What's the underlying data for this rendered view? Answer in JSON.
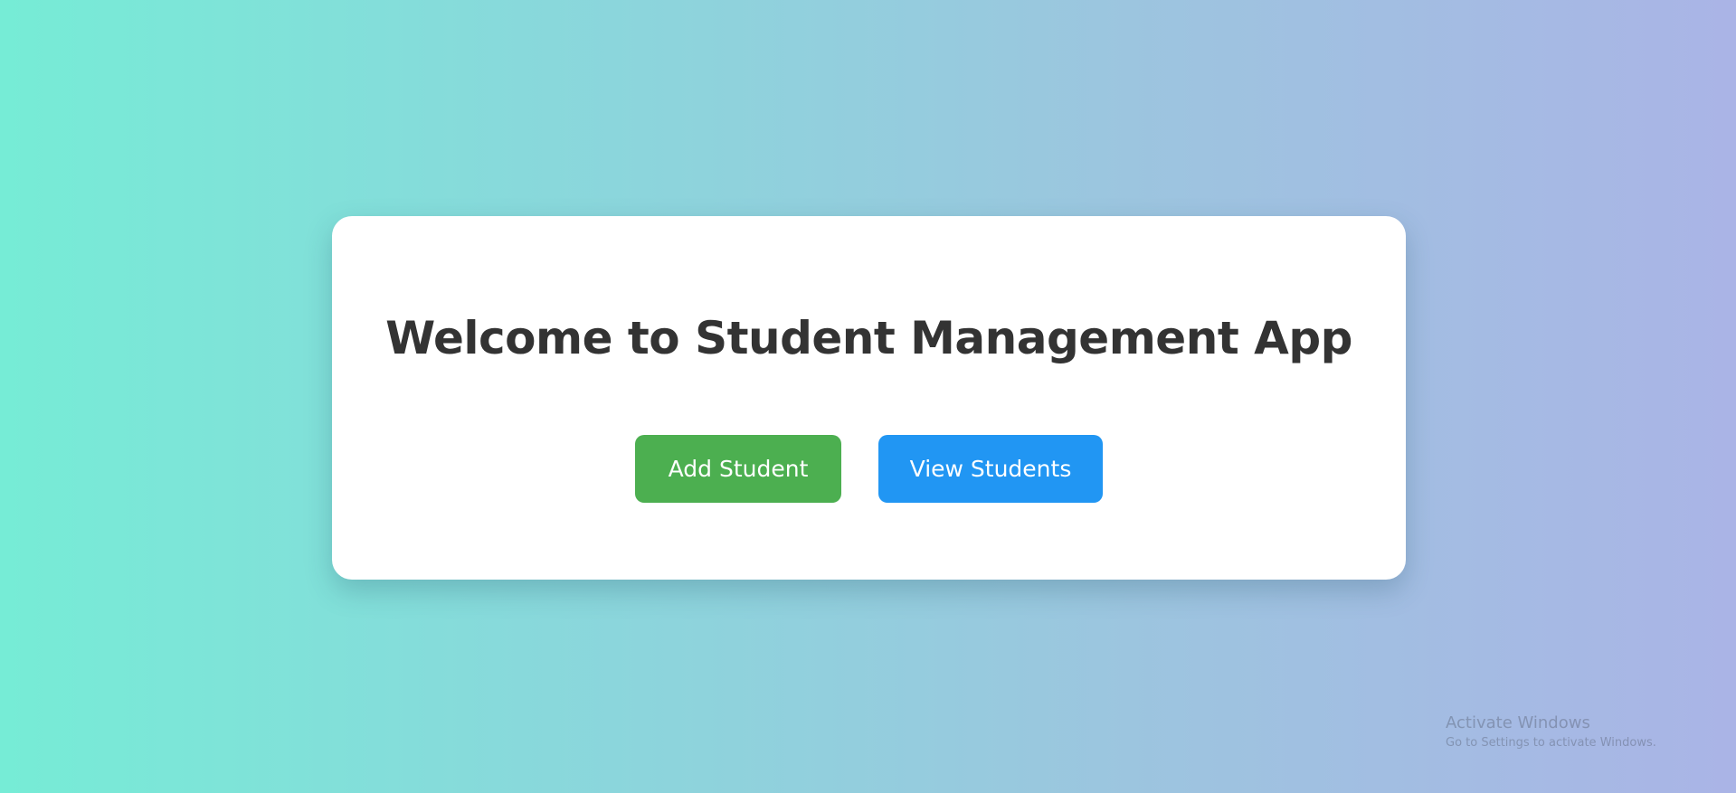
{
  "main": {
    "title": "Welcome to Student Management App",
    "buttons": {
      "add_label": "Add Student",
      "view_label": "View Students"
    }
  },
  "colors": {
    "add_button": "#4caf50",
    "view_button": "#2196f3",
    "title_text": "#333333",
    "card_background": "#ffffff",
    "background_gradient_start": "#76ecd6",
    "background_gradient_end": "#aab4e6"
  },
  "watermark": {
    "title": "Activate Windows",
    "subtitle": "Go to Settings to activate Windows."
  }
}
